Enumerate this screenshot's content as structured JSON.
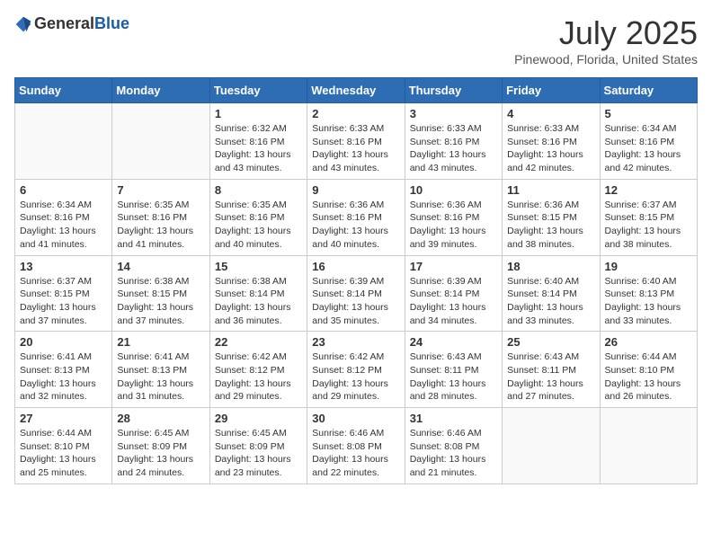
{
  "header": {
    "logo_general": "General",
    "logo_blue": "Blue",
    "title": "July 2025",
    "subtitle": "Pinewood, Florida, United States"
  },
  "weekdays": [
    "Sunday",
    "Monday",
    "Tuesday",
    "Wednesday",
    "Thursday",
    "Friday",
    "Saturday"
  ],
  "weeks": [
    [
      {
        "day": "",
        "info": ""
      },
      {
        "day": "",
        "info": ""
      },
      {
        "day": "1",
        "info": "Sunrise: 6:32 AM\nSunset: 8:16 PM\nDaylight: 13 hours and 43 minutes."
      },
      {
        "day": "2",
        "info": "Sunrise: 6:33 AM\nSunset: 8:16 PM\nDaylight: 13 hours and 43 minutes."
      },
      {
        "day": "3",
        "info": "Sunrise: 6:33 AM\nSunset: 8:16 PM\nDaylight: 13 hours and 43 minutes."
      },
      {
        "day": "4",
        "info": "Sunrise: 6:33 AM\nSunset: 8:16 PM\nDaylight: 13 hours and 42 minutes."
      },
      {
        "day": "5",
        "info": "Sunrise: 6:34 AM\nSunset: 8:16 PM\nDaylight: 13 hours and 42 minutes."
      }
    ],
    [
      {
        "day": "6",
        "info": "Sunrise: 6:34 AM\nSunset: 8:16 PM\nDaylight: 13 hours and 41 minutes."
      },
      {
        "day": "7",
        "info": "Sunrise: 6:35 AM\nSunset: 8:16 PM\nDaylight: 13 hours and 41 minutes."
      },
      {
        "day": "8",
        "info": "Sunrise: 6:35 AM\nSunset: 8:16 PM\nDaylight: 13 hours and 40 minutes."
      },
      {
        "day": "9",
        "info": "Sunrise: 6:36 AM\nSunset: 8:16 PM\nDaylight: 13 hours and 40 minutes."
      },
      {
        "day": "10",
        "info": "Sunrise: 6:36 AM\nSunset: 8:16 PM\nDaylight: 13 hours and 39 minutes."
      },
      {
        "day": "11",
        "info": "Sunrise: 6:36 AM\nSunset: 8:15 PM\nDaylight: 13 hours and 38 minutes."
      },
      {
        "day": "12",
        "info": "Sunrise: 6:37 AM\nSunset: 8:15 PM\nDaylight: 13 hours and 38 minutes."
      }
    ],
    [
      {
        "day": "13",
        "info": "Sunrise: 6:37 AM\nSunset: 8:15 PM\nDaylight: 13 hours and 37 minutes."
      },
      {
        "day": "14",
        "info": "Sunrise: 6:38 AM\nSunset: 8:15 PM\nDaylight: 13 hours and 37 minutes."
      },
      {
        "day": "15",
        "info": "Sunrise: 6:38 AM\nSunset: 8:14 PM\nDaylight: 13 hours and 36 minutes."
      },
      {
        "day": "16",
        "info": "Sunrise: 6:39 AM\nSunset: 8:14 PM\nDaylight: 13 hours and 35 minutes."
      },
      {
        "day": "17",
        "info": "Sunrise: 6:39 AM\nSunset: 8:14 PM\nDaylight: 13 hours and 34 minutes."
      },
      {
        "day": "18",
        "info": "Sunrise: 6:40 AM\nSunset: 8:14 PM\nDaylight: 13 hours and 33 minutes."
      },
      {
        "day": "19",
        "info": "Sunrise: 6:40 AM\nSunset: 8:13 PM\nDaylight: 13 hours and 33 minutes."
      }
    ],
    [
      {
        "day": "20",
        "info": "Sunrise: 6:41 AM\nSunset: 8:13 PM\nDaylight: 13 hours and 32 minutes."
      },
      {
        "day": "21",
        "info": "Sunrise: 6:41 AM\nSunset: 8:13 PM\nDaylight: 13 hours and 31 minutes."
      },
      {
        "day": "22",
        "info": "Sunrise: 6:42 AM\nSunset: 8:12 PM\nDaylight: 13 hours and 29 minutes."
      },
      {
        "day": "23",
        "info": "Sunrise: 6:42 AM\nSunset: 8:12 PM\nDaylight: 13 hours and 29 minutes."
      },
      {
        "day": "24",
        "info": "Sunrise: 6:43 AM\nSunset: 8:11 PM\nDaylight: 13 hours and 28 minutes."
      },
      {
        "day": "25",
        "info": "Sunrise: 6:43 AM\nSunset: 8:11 PM\nDaylight: 13 hours and 27 minutes."
      },
      {
        "day": "26",
        "info": "Sunrise: 6:44 AM\nSunset: 8:10 PM\nDaylight: 13 hours and 26 minutes."
      }
    ],
    [
      {
        "day": "27",
        "info": "Sunrise: 6:44 AM\nSunset: 8:10 PM\nDaylight: 13 hours and 25 minutes."
      },
      {
        "day": "28",
        "info": "Sunrise: 6:45 AM\nSunset: 8:09 PM\nDaylight: 13 hours and 24 minutes."
      },
      {
        "day": "29",
        "info": "Sunrise: 6:45 AM\nSunset: 8:09 PM\nDaylight: 13 hours and 23 minutes."
      },
      {
        "day": "30",
        "info": "Sunrise: 6:46 AM\nSunset: 8:08 PM\nDaylight: 13 hours and 22 minutes."
      },
      {
        "day": "31",
        "info": "Sunrise: 6:46 AM\nSunset: 8:08 PM\nDaylight: 13 hours and 21 minutes."
      },
      {
        "day": "",
        "info": ""
      },
      {
        "day": "",
        "info": ""
      }
    ]
  ]
}
